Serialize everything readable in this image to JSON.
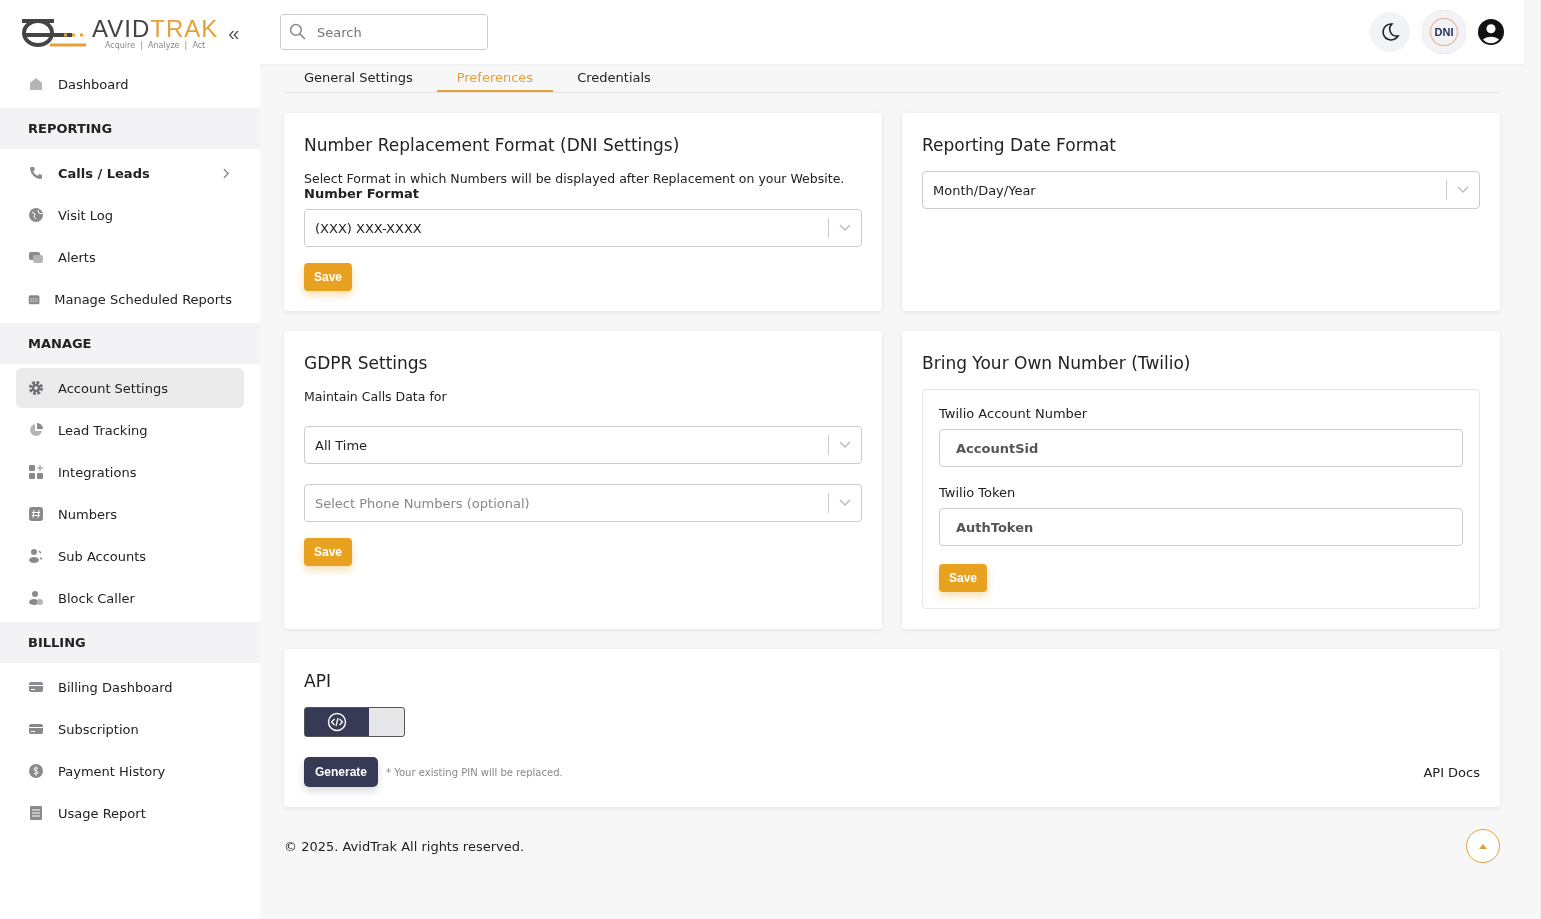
{
  "logo": {
    "primary": "AVID",
    "accent": "TRAK",
    "tagline": "Acquire  |  Analyze  |  Act",
    "collapse": "«"
  },
  "sidebar": {
    "sections": [
      {
        "items": [
          {
            "label": "Dashboard",
            "selected": false
          }
        ]
      },
      {
        "heading": "REPORTING",
        "items": [
          {
            "label": "Calls / Leads",
            "selected": false,
            "expandable": true
          },
          {
            "label": "Visit Log",
            "selected": false
          },
          {
            "label": "Alerts",
            "selected": false
          },
          {
            "label": "Manage Scheduled Reports",
            "selected": false
          }
        ]
      },
      {
        "heading": "MANAGE",
        "items": [
          {
            "label": "Account Settings",
            "selected": true
          },
          {
            "label": "Lead Tracking",
            "selected": false
          },
          {
            "label": "Integrations",
            "selected": false
          },
          {
            "label": "Numbers",
            "selected": false
          },
          {
            "label": "Sub Accounts",
            "selected": false
          },
          {
            "label": "Block Caller",
            "selected": false
          }
        ]
      },
      {
        "heading": "BILLING",
        "items": [
          {
            "label": "Billing Dashboard",
            "selected": false
          },
          {
            "label": "Subscription",
            "selected": false
          },
          {
            "label": "Payment History",
            "selected": false
          },
          {
            "label": "Usage Report",
            "selected": false
          }
        ]
      }
    ]
  },
  "search": {
    "placeholder": "Search"
  },
  "header": {
    "badge": "DNI"
  },
  "tabs": [
    {
      "label": "General Settings",
      "selected": false
    },
    {
      "label": "Preferences",
      "selected": true
    },
    {
      "label": "Credentials",
      "selected": false
    }
  ],
  "dni": {
    "title": "Number Replacement Format (DNI Settings)",
    "description": "Select Format in which Numbers will be displayed after Replacement on your Website.",
    "field_label": "Number Format",
    "value": "(XXX) XXX-XXXX",
    "button": "Save"
  },
  "date_format": {
    "title": "Reporting Date Format",
    "value": "Month/Day/Year"
  },
  "gdpr": {
    "title": "GDPR Settings",
    "label": "Maintain Calls Data for",
    "value": "All Time",
    "numbers_placeholder": "Select Phone Numbers (optional)",
    "button": "Save"
  },
  "twilio": {
    "title": "Bring Your Own Number (Twilio)",
    "account_label": "Twilio Account Number",
    "account_placeholder": "AccountSid",
    "token_label": "Twilio Token",
    "token_placeholder": "AuthToken",
    "button": "Save"
  },
  "api": {
    "title": "API",
    "toggle_on": true,
    "button": "Generate",
    "note": "* Your existing PIN will be replaced.",
    "docs": "API Docs"
  },
  "footer": "© 2025. AvidTrak All rights reserved."
}
